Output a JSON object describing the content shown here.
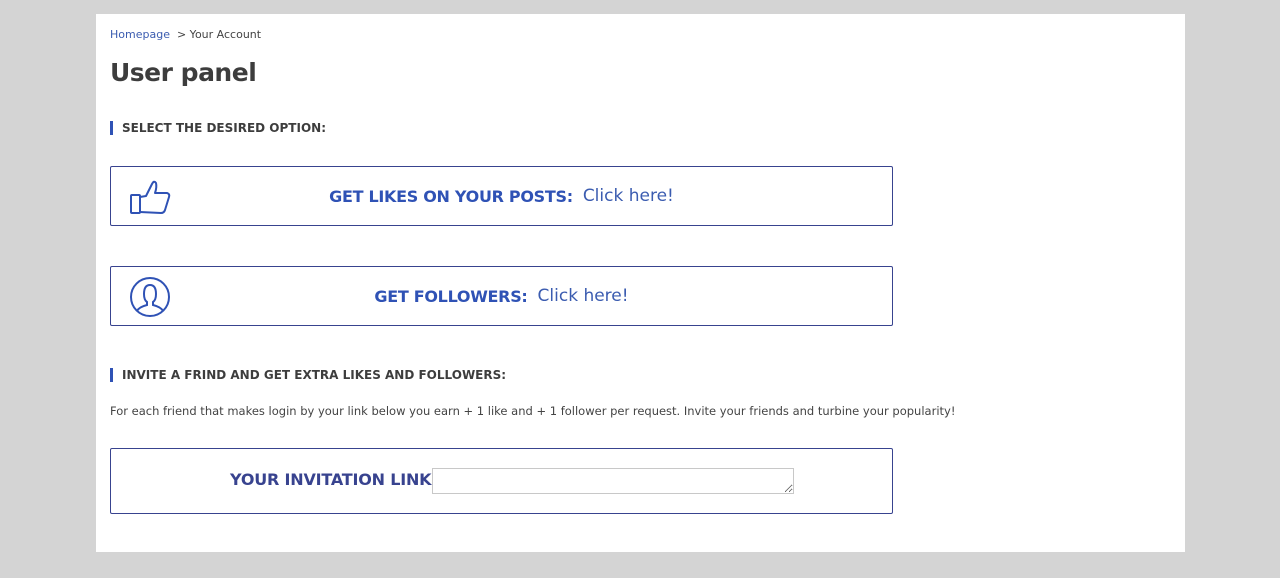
{
  "breadcrumb": {
    "home": "Homepage",
    "current": "> Your Account"
  },
  "page": {
    "title": "User panel"
  },
  "options_section": {
    "heading": "SELECT THE DESIRED OPTION:"
  },
  "options": [
    {
      "icon": "thumbs-up-icon",
      "label": "GET LIKES ON YOUR POSTS:",
      "link": "Click here!"
    },
    {
      "icon": "user-icon",
      "label": "GET FOLLOWERS:",
      "link": "Click here!"
    }
  ],
  "invite_section": {
    "heading": "INVITE A FRIND AND GET EXTRA LIKES AND FOLLOWERS:",
    "description": "For each friend that makes login by your link below you earn + 1 like and + 1 follower per request. Invite your friends and turbine your popularity!",
    "link_label": "YOUR INVITATION LINK:",
    "link_value": ""
  },
  "colors": {
    "accent": "#2f52b5",
    "border": "#38438f",
    "page_background": "#d4d4d4",
    "panel_background": "#ffffff",
    "text": "#3d3d3d"
  }
}
